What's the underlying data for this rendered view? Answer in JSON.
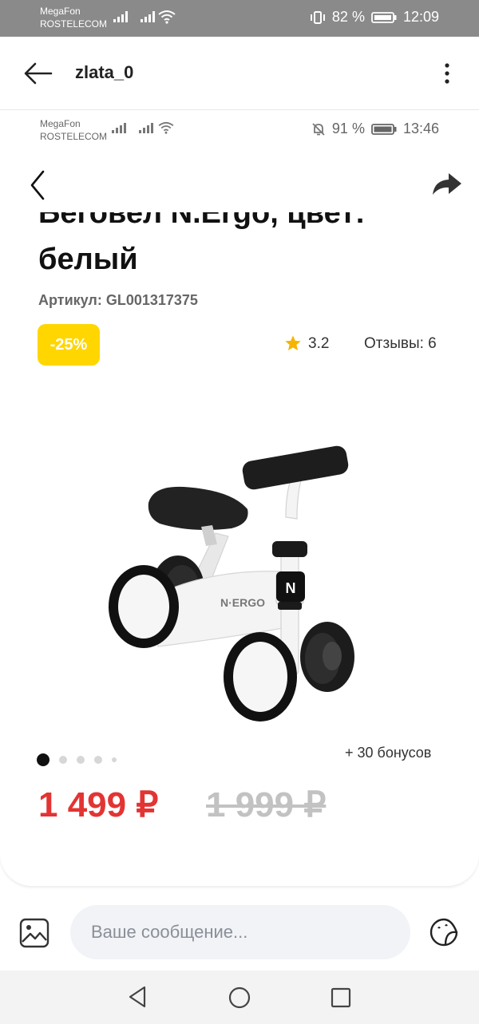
{
  "status_bar": {
    "carrier1": "MegaFon",
    "carrier2": "ROSTELECOM",
    "battery": "82 %",
    "time": "12:09"
  },
  "chat": {
    "username": "zlata_0",
    "message_placeholder": "Ваше сообщение..."
  },
  "shared_screenshot": {
    "status": {
      "carrier1": "MegaFon",
      "carrier2": "ROSTELECOM",
      "battery": "91 %",
      "time": "13:46"
    },
    "product": {
      "title_line1": "Беговел N.Ergo, цвет:",
      "title_line2": "белый",
      "article": "Артикул: GL001317375",
      "discount": "-25%",
      "rating": "3.2",
      "reviews": "Отзывы: 6",
      "bonus": "+ 30 бонусов",
      "price_new": "1 499 ₽",
      "price_old": "1 999 ₽",
      "logo_text": "N·ERGO",
      "logo_badge": "N"
    },
    "carousel": {
      "slide_count": 5,
      "active_index": 0
    }
  },
  "colors": {
    "discount_bg": "#ffd600",
    "price_new": "#e33434",
    "price_old": "#c2c2c2",
    "star": "#f5b400",
    "status_bar_bg": "#8a8a8a"
  },
  "icons": [
    "back-arrow-icon",
    "more-vert-icon",
    "chevron-left-icon",
    "share-icon",
    "star-icon",
    "gallery-icon",
    "sticker-icon",
    "nav-back-icon",
    "nav-home-icon",
    "nav-recent-icon",
    "wifi-icon",
    "signal-icon",
    "battery-icon",
    "vibrate-icon",
    "mute-bell-icon"
  ]
}
